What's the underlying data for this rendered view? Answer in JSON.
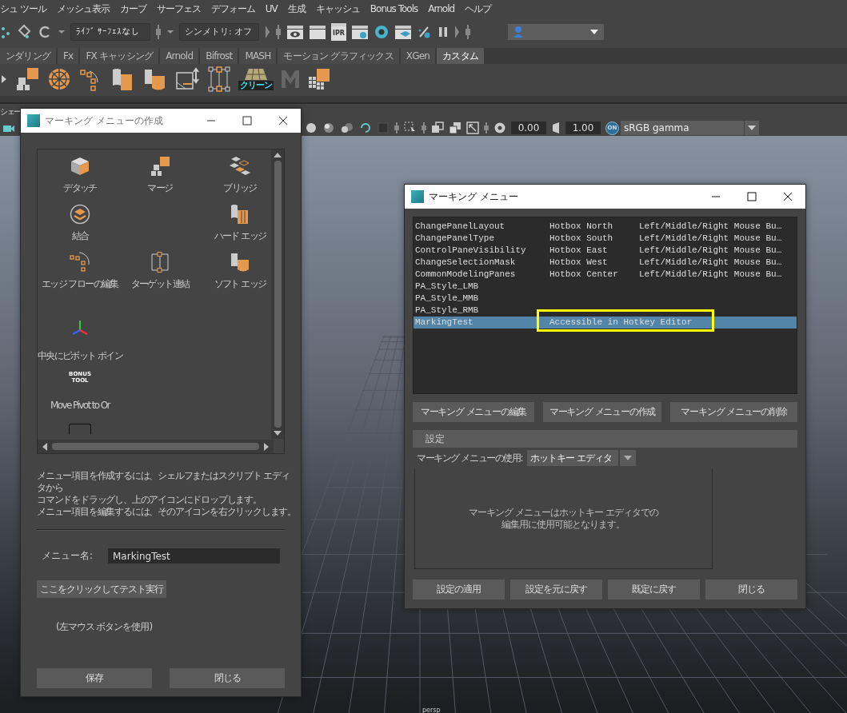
{
  "menu_bar": {
    "items": [
      "シュ ツール",
      "メッシュ表示",
      "カーブ",
      "サーフェス",
      "デフォーム",
      "UV",
      "生成",
      "キャッシュ",
      "Bonus Tools",
      "Arnold",
      "ヘルプ"
    ]
  },
  "status_line": {
    "live_surface": "ﾗｲﾌﾞ ｻｰﾌｪｽなし",
    "symmetry": "シンメトリ: オフ",
    "ipr_badge": "IPR"
  },
  "shelf": {
    "tabs": [
      {
        "label": "ンダリング",
        "selected": false
      },
      {
        "label": "Fx",
        "selected": false
      },
      {
        "label": "FX キャッシング",
        "selected": false
      },
      {
        "label": "Arnold",
        "selected": false
      },
      {
        "label": "Bifrost",
        "selected": false
      },
      {
        "label": "MASH",
        "selected": false
      },
      {
        "label": "モーション グラフィックス",
        "selected": false
      },
      {
        "label": "XGen",
        "selected": false
      },
      {
        "label": "カスタム",
        "selected": true
      }
    ],
    "clean_label": "クリーン"
  },
  "panel_toolbar": {
    "menu_fragment": "シェー",
    "exposure": "0.00",
    "gamma": "1.00",
    "toggle": "ON",
    "view_transform": "sRGB gamma"
  },
  "viewport": {
    "camera_label": "persp"
  },
  "create_window": {
    "title": "マーキング メニューの作成",
    "slots": [
      {
        "kind": "tool",
        "label": "デタッチ"
      },
      {
        "kind": "tool",
        "label": "マージ"
      },
      {
        "kind": "tool",
        "label": "ブリッジ"
      },
      {
        "kind": "tool",
        "label": "結合"
      },
      {
        "kind": "blank"
      },
      {
        "kind": "tool",
        "label": "ハード エッジ"
      },
      {
        "kind": "tool",
        "label": "エッジ フローの編集"
      },
      {
        "kind": "tool",
        "label": "ターゲット連結"
      },
      {
        "kind": "tool",
        "label": "ソフト エッジ"
      },
      {
        "kind": "tool",
        "label": "中央にピボット ポイン"
      },
      {
        "kind": "blank"
      },
      {
        "kind": "blank"
      },
      {
        "kind": "bonus",
        "icon_text": [
          "BONUS",
          "TOOL"
        ],
        "label": "Move Pivot to Or"
      },
      {
        "kind": "blank"
      },
      {
        "kind": "blank"
      },
      {
        "kind": "empty_slot"
      }
    ],
    "instructions": [
      "メニュー項目を作成するには、シェルフまたはスクリプト エディタから",
      "コマンドをドラッグし、上のアイコンにドロップします。",
      "メニュー項目を編集するには、そのアイコンを右クリックします。"
    ],
    "name_label": "メニュー名:",
    "name_value": "MarkingTest",
    "test_button": "ここをクリックしてテスト実行",
    "test_note": "(左マウス ボタンを使用)",
    "buttons": [
      "保存",
      "閉じる"
    ]
  },
  "marking_window": {
    "title": "マーキング メニュー",
    "rows": [
      {
        "name": "ChangePanelLayout",
        "column_2": "Hotbox North",
        "column_3": "Left/Middle/Right Mouse Bu…",
        "selected": false,
        "boxed": false
      },
      {
        "name": "ChangePanelType",
        "column_2": "Hotbox South",
        "column_3": "Left/Middle/Right Mouse Bu…",
        "selected": false,
        "boxed": false
      },
      {
        "name": "ControlPaneVisibility",
        "column_2": "Hotbox East",
        "column_3": "Left/Middle/Right Mouse Bu…",
        "selected": false,
        "boxed": false
      },
      {
        "name": "ChangeSelectionMask",
        "column_2": "Hotbox West",
        "column_3": "Left/Middle/Right Mouse Bu…",
        "selected": false,
        "boxed": false
      },
      {
        "name": "CommonModelingPanes",
        "column_2": "Hotbox Center",
        "column_3": "Left/Middle/Right Mouse Bu…",
        "selected": false,
        "boxed": false
      },
      {
        "name": "PA_Style_LMB",
        "selected": false,
        "boxed": false
      },
      {
        "name": "PA_Style_MMB",
        "selected": false,
        "boxed": false
      },
      {
        "name": "PA_Style_RMB",
        "selected": false,
        "boxed": false
      },
      {
        "name": "MarkingTest",
        "column_2": "Accessible in Hotkey Editor",
        "selected": true,
        "boxed": true
      }
    ],
    "actions": [
      "マーキング メニューの編集",
      "マーキング メニューの作成",
      "マーキング メニューの削除"
    ],
    "settings_header": "設定",
    "usage_label": "マーキング メニューの使用:",
    "usage_value": "ホットキー エディタ",
    "info": [
      "マーキング メニューはホットキー エディタでの",
      "編集用に使用可能となります。"
    ],
    "buttons": [
      "設定の適用",
      "設定を元に戻す",
      "既定に戻す",
      "閉じる"
    ]
  }
}
